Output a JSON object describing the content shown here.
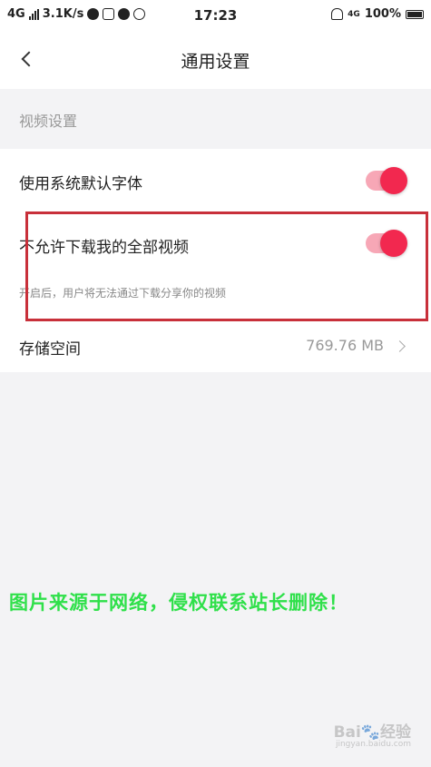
{
  "status_bar": {
    "network": "4G",
    "speed": "3.1K/s",
    "time": "17:23",
    "network_right": "4G",
    "battery": "100%"
  },
  "nav": {
    "title": "通用设置",
    "back_icon": "chevron-left-icon"
  },
  "section": {
    "header": "视频设置"
  },
  "settings": {
    "system_font": {
      "label": "使用系统默认字体",
      "enabled": true
    },
    "disallow_download": {
      "label": "不允许下载我的全部视频",
      "enabled": true,
      "description": "开启后，用户将无法通过下载分享你的视频"
    },
    "storage": {
      "label": "存储空间",
      "value": "769.76 MB"
    }
  },
  "overlay": {
    "watermark": "图片来源于网络，侵权联系站长删除！",
    "baidu_mark": "Bai🐾经验",
    "baidu_sub": "jingyan.baidu.com"
  },
  "colors": {
    "accent": "#f2284f",
    "toggle_track": "#f7a7b6",
    "highlight": "#c8303a",
    "watermark": "#2fe04a"
  }
}
